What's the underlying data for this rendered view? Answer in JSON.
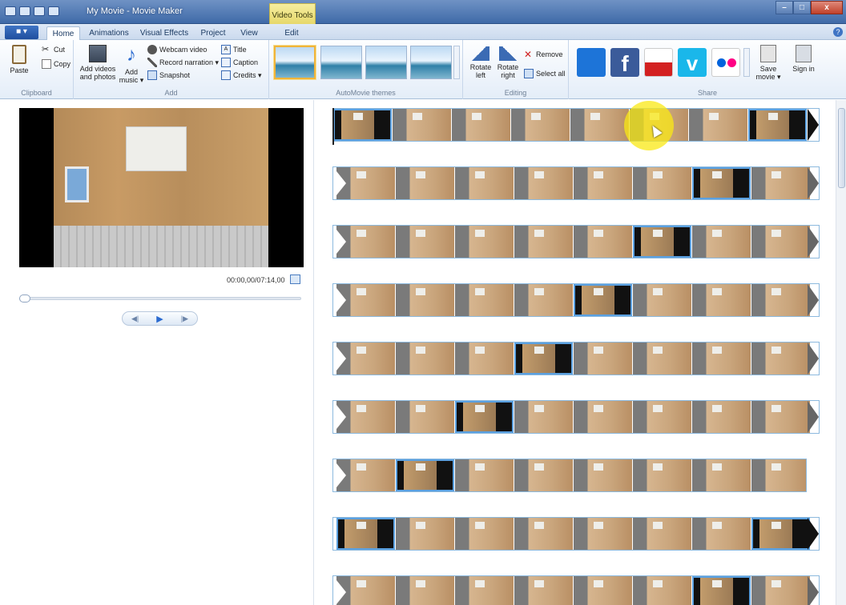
{
  "window": {
    "title": "My Movie - Movie Maker",
    "context_tab": "Video Tools",
    "minimize": "–",
    "maximize": "□",
    "close": "x"
  },
  "tabs": {
    "file": "■ ▾",
    "items": [
      {
        "label": "Home"
      },
      {
        "label": "Animations"
      },
      {
        "label": "Visual Effects"
      },
      {
        "label": "Project"
      },
      {
        "label": "View"
      },
      {
        "label": "Edit"
      }
    ]
  },
  "ribbon": {
    "clipboard": {
      "label": "Clipboard",
      "paste": "Paste",
      "cut": "Cut",
      "copy": "Copy"
    },
    "add": {
      "label": "Add",
      "add_videos": "Add videos and photos",
      "add_music": "Add music ▾",
      "webcam": "Webcam video",
      "narration": "Record narration ▾",
      "snapshot": "Snapshot",
      "title": "Title",
      "caption": "Caption",
      "credits": "Credits ▾"
    },
    "themes": {
      "label": "AutoMovie themes"
    },
    "editing": {
      "label": "Editing",
      "rotate_left": "Rotate left",
      "rotate_right": "Rotate right",
      "remove": "Remove",
      "select_all": "Select all"
    },
    "share": {
      "label": "Share",
      "save_movie": "Save movie ▾",
      "sign_in": "Sign in",
      "services": [
        "SkyDrive",
        "Facebook",
        "YouTube",
        "Vimeo",
        "Flickr"
      ]
    }
  },
  "preview": {
    "timecode": "00:00,00/07:14,00",
    "progress": 0
  },
  "storyboard": {
    "rows": 9
  },
  "colors": {
    "accent": "#3f74c4",
    "selection": "#5aa0e0",
    "cursor_highlight": "#fae814"
  }
}
